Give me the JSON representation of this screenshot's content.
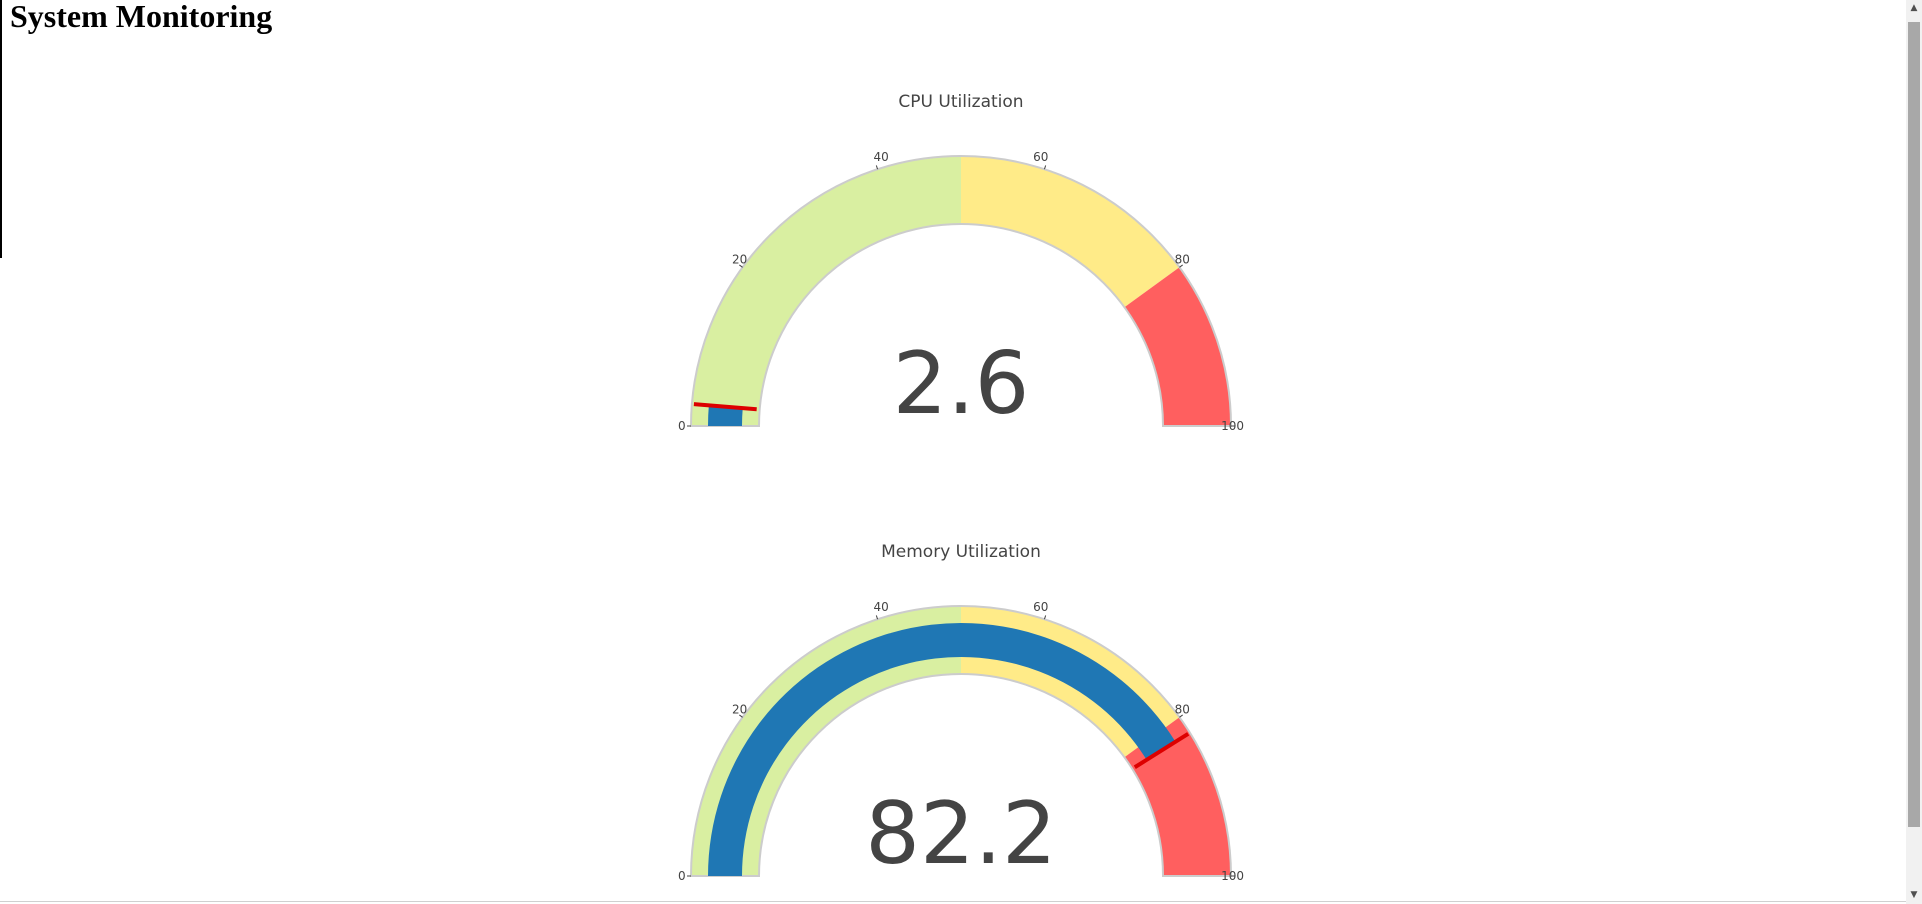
{
  "page": {
    "title": "System Monitoring"
  },
  "colors": {
    "green_band": "#d9efa1",
    "yellow_band": "#ffeb88",
    "red_band": "#ff5f5f",
    "value_bar": "#1f77b4",
    "threshold": "#dd0000",
    "border": "#cccccc"
  },
  "scrollbar": {
    "up_icon": "triangle-up",
    "down_icon": "triangle-down"
  },
  "chart_data": [
    {
      "type": "gauge",
      "title": "CPU Utilization",
      "value": 2.6,
      "value_label": "2.6",
      "threshold": 2.6,
      "range": [
        0,
        100
      ],
      "ticks": [
        0,
        20,
        40,
        60,
        80,
        100
      ],
      "tick_labels": [
        "0",
        "20",
        "40",
        "60",
        "80",
        "100"
      ],
      "steps": [
        {
          "range": [
            0,
            50
          ],
          "color": "#d9efa1"
        },
        {
          "range": [
            50,
            80
          ],
          "color": "#ffeb88"
        },
        {
          "range": [
            80,
            100
          ],
          "color": "#ff5f5f"
        }
      ]
    },
    {
      "type": "gauge",
      "title": "Memory Utilization",
      "value": 82.2,
      "value_label": "82.2",
      "threshold": 82.2,
      "range": [
        0,
        100
      ],
      "ticks": [
        0,
        20,
        40,
        60,
        80,
        100
      ],
      "tick_labels": [
        "0",
        "20",
        "40",
        "60",
        "80",
        "100"
      ],
      "steps": [
        {
          "range": [
            0,
            50
          ],
          "color": "#d9efa1"
        },
        {
          "range": [
            50,
            80
          ],
          "color": "#ffeb88"
        },
        {
          "range": [
            80,
            100
          ],
          "color": "#ff5f5f"
        }
      ]
    }
  ]
}
